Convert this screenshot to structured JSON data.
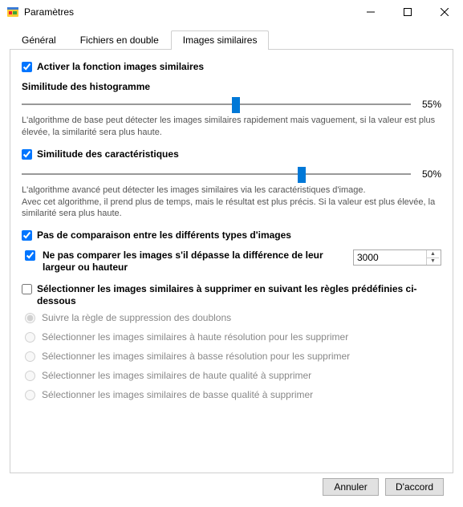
{
  "window": {
    "title": "Paramètres"
  },
  "tabs": {
    "general": "Général",
    "duplicates": "Fichiers en double",
    "similar": "Images similaires"
  },
  "enable": {
    "label": "Activer la fonction images similaires"
  },
  "histogram": {
    "title": "Similitude des histogramme",
    "value": "55%",
    "percent": 55,
    "desc": "L'algorithme de base peut détecter les images similaires rapidement mais vaguement, si la valeur est plus élevée, la similarité sera plus haute."
  },
  "features": {
    "label": "Similitude des caractéristiques",
    "value": "50%",
    "percent": 50,
    "desc": "L'algorithme avancé peut détecter les images similaires via les caractéristiques d'image.\nAvec cet algorithme, il prend plus de temps, mais le résultat est plus précis. Si la valeur est plus élevée, la similarité sera plus haute."
  },
  "noCompareTypes": {
    "label": "Pas de comparaison entre les différents types d'images"
  },
  "sizeDiff": {
    "label": "Ne pas comparer les images s'il dépasse la différence de leur largeur ou hauteur",
    "value": "3000"
  },
  "rules": {
    "label": "Sélectionner les images similaires à supprimer en suivant les règles prédéfinies ci-dessous",
    "options": {
      "r1": "Suivre la règle de suppression des doublons",
      "r2": "Sélectionner les images similaires à haute résolution pour les supprimer",
      "r3": "Sélectionner les images similaires à basse résolution pour les supprimer",
      "r4": "Sélectionner les images similaires de haute qualité à supprimer",
      "r5": "Sélectionner les images similaires de basse qualité à supprimer"
    }
  },
  "buttons": {
    "cancel": "Annuler",
    "ok": "D'accord"
  }
}
